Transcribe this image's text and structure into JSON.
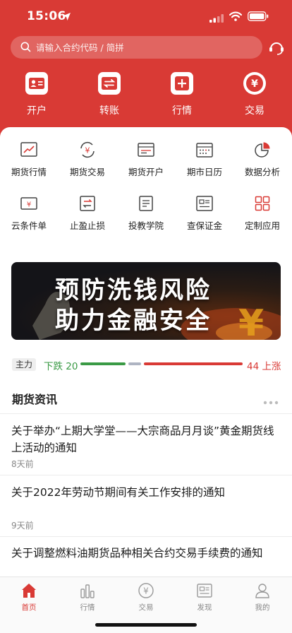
{
  "status": {
    "time": "15:06"
  },
  "search": {
    "placeholder": "请输入合约代码 / 简拼"
  },
  "quick_actions": [
    {
      "label": "开户",
      "icon": "id-card-icon"
    },
    {
      "label": "转账",
      "icon": "transfer-icon"
    },
    {
      "label": "行情",
      "icon": "plus-icon"
    },
    {
      "label": "交易",
      "icon": "yen-icon"
    }
  ],
  "grid": [
    {
      "label": "期货行情",
      "icon": "chart-trend-icon"
    },
    {
      "label": "期货交易",
      "icon": "yen-exchange-icon"
    },
    {
      "label": "期货开户",
      "icon": "form-icon"
    },
    {
      "label": "期市日历",
      "icon": "calendar-icon"
    },
    {
      "label": "数据分析",
      "icon": "pie-chart-icon"
    },
    {
      "label": "云条件单",
      "icon": "ticket-icon"
    },
    {
      "label": "止盈止损",
      "icon": "swap-icon"
    },
    {
      "label": "投教学院",
      "icon": "document-icon"
    },
    {
      "label": "查保证金",
      "icon": "card-icon"
    },
    {
      "label": "定制应用",
      "icon": "apps-grid-icon"
    }
  ],
  "banner": {
    "line1": "预防洗钱风险",
    "line2": "助力金融安全"
  },
  "market": {
    "tag": "主力",
    "down_label": "下跌 20",
    "up_label": "44 上涨",
    "down_count": 20,
    "up_count": 44,
    "colors": {
      "down": "#3a9a45",
      "up": "#d93a35",
      "flat": "#aeb4c2"
    }
  },
  "news": {
    "title": "期货资讯",
    "items": [
      {
        "title": "关于举办“上期大学堂——大宗商品月月谈”黄金期货线上活动的通知",
        "time": "8天前"
      },
      {
        "title": "关于2022年劳动节期间有关工作安排的通知",
        "time": "9天前"
      },
      {
        "title": "关于调整燃料油期货品种相关合约交易手续费的通知",
        "time": ""
      }
    ]
  },
  "tabs": [
    {
      "label": "首页",
      "icon": "home-icon",
      "active": true
    },
    {
      "label": "行情",
      "icon": "bar-chart-icon",
      "active": false
    },
    {
      "label": "交易",
      "icon": "yen-circle-icon",
      "active": false
    },
    {
      "label": "发现",
      "icon": "news-icon",
      "active": false
    },
    {
      "label": "我的",
      "icon": "user-icon",
      "active": false
    }
  ],
  "colors": {
    "brand": "#d93a35"
  }
}
